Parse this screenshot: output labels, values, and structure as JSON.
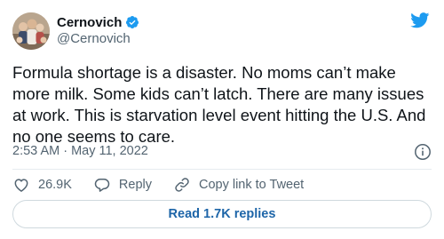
{
  "author": {
    "name": "Cernovich",
    "handle": "@Cernovich",
    "verified": true
  },
  "tweet": {
    "text": "Formula shortage is a disaster. No moms can’t make more milk. Some kids can’t latch. There are many issues at work. This is starvation level event hitting the U.S. And no one seems to care.",
    "timestamp": "2:53 AM · May 11, 2022"
  },
  "actions": {
    "likes": "26.9K",
    "reply_label": "Reply",
    "copy_link_label": "Copy link to Tweet"
  },
  "replies_button": "Read 1.7K replies",
  "icons": {
    "avatar": "avatar-photo",
    "verified": "verified-badge-icon",
    "brand": "twitter-bird-icon",
    "info": "info-icon",
    "like": "heart-icon",
    "reply": "reply-bubble-icon",
    "copy": "link-icon"
  },
  "colors": {
    "twitter_blue": "#1d9bf0",
    "text": "#0f1419",
    "secondary": "#536471",
    "link": "#1d65a8",
    "border": "#cfd9de"
  }
}
